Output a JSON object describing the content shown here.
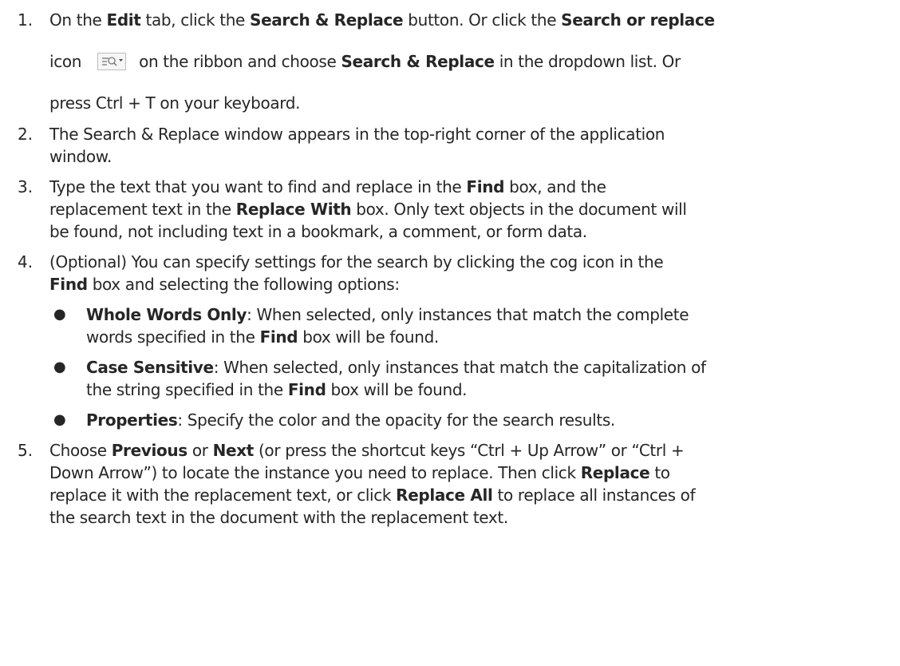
{
  "steps": [
    {
      "num": "1.",
      "l1": [
        "On the ",
        "Edit",
        " tab, click the ",
        "Search & Replace",
        " button. Or click the ",
        "Search or replace"
      ],
      "l2": [
        "icon ",
        " on the ribbon and choose ",
        "Search & Replace",
        " in the dropdown list. Or"
      ],
      "l3": "press Ctrl + T on your keyboard."
    },
    {
      "num": "2.",
      "l1": "The Search & Replace window appears in the top-right corner of the application",
      "l2": "window."
    },
    {
      "num": "3.",
      "l1": [
        "Type the text that you want to find and replace in the ",
        "Find",
        " box, and the"
      ],
      "l2": [
        "replacement text in the ",
        "Replace With",
        " box. Only text objects in the document will"
      ],
      "l3": "be found, not including text in a bookmark, a comment, or form data."
    },
    {
      "num": "4.",
      "l1": "(Optional) You can specify settings for the search by clicking the cog icon in the",
      "l2": [
        "Find",
        " box and selecting the following options:"
      ],
      "bullets": [
        {
          "a": [
            "Whole Words Only",
            ": When selected, only instances that match the complete"
          ],
          "b": [
            "words specified in the ",
            "Find",
            " box will be found."
          ]
        },
        {
          "a": [
            "Case Sensitive",
            ": When selected, only instances that match the capitalization of"
          ],
          "b": [
            "the string specified in the ",
            "Find",
            " box will be found."
          ]
        },
        {
          "a": [
            "Properties",
            ": Specify the color and the opacity for the search results."
          ]
        }
      ]
    },
    {
      "num": "5.",
      "l1": [
        "Choose ",
        "Previous",
        " or ",
        "Next",
        " (or press the shortcut keys “Ctrl + Up Arrow” or “Ctrl +"
      ],
      "l2": [
        "Down Arrow”) to locate the instance you need to replace. Then click ",
        "Replace",
        " to"
      ],
      "l3": [
        "replace it with the replacement text, or click ",
        "Replace All",
        " to replace all instances of"
      ],
      "l4": "the search text in the document with the replacement text."
    }
  ],
  "icons": {
    "ribbon": "search-or-replace-icon"
  }
}
